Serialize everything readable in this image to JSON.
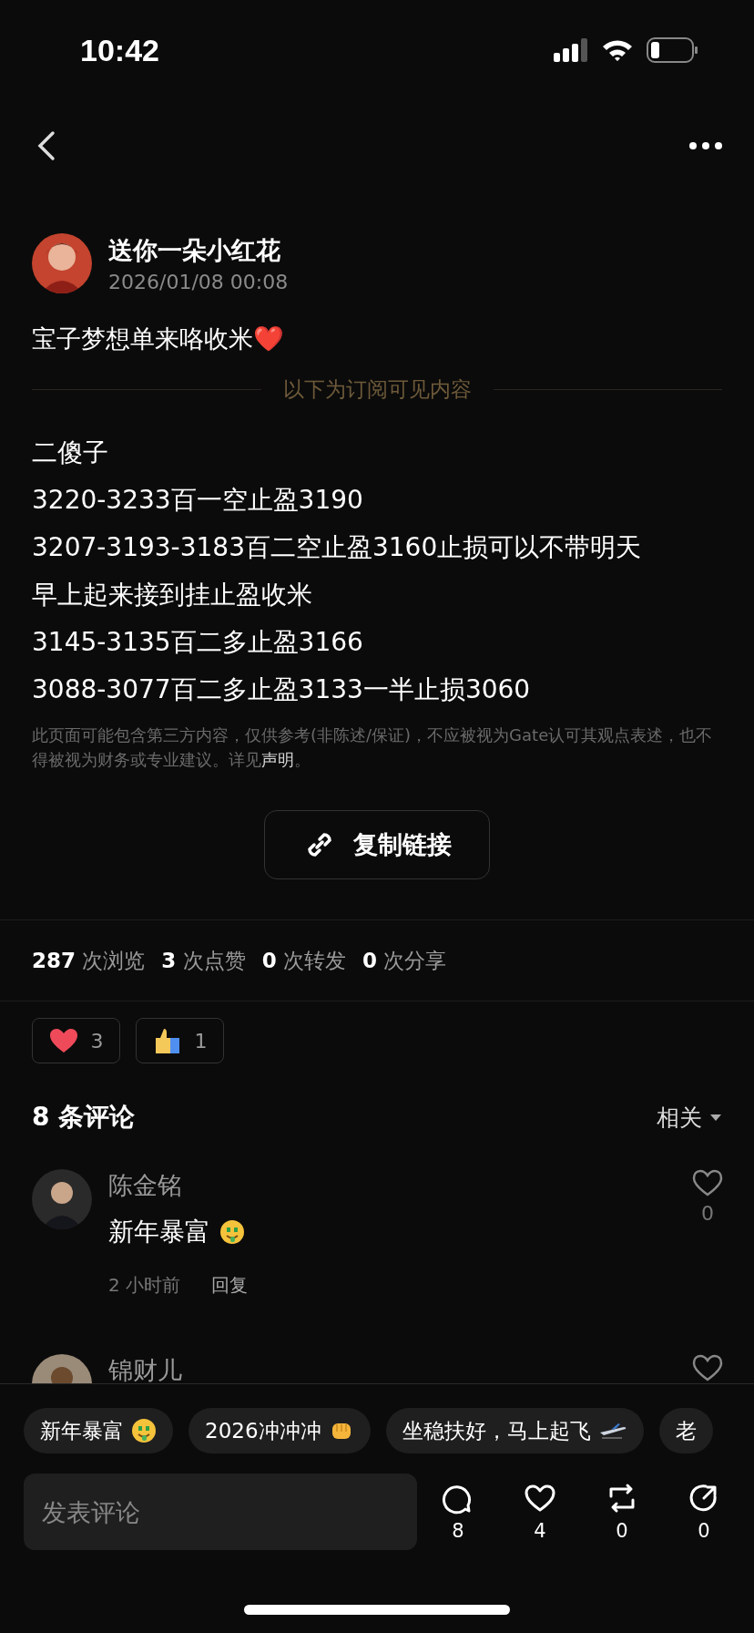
{
  "status_bar": {
    "time": "10:42"
  },
  "post": {
    "author": "送你一朵小红花",
    "date": "2026/01/08 00:08",
    "intro": "宝子梦想单来咯收米❤️",
    "divider_label": "以下为订阅可见内容",
    "lines": [
      "二傻子",
      "3220-3233百一空止盈3190",
      "3207-3193-3183百二空止盈3160止损可以不带明天",
      "早上起来接到挂止盈收米",
      "3145-3135百二多止盈3166",
      "3088-3077百二多止盈3133一半止损3060"
    ],
    "disclaimer": "此页面可能包含第三方内容，仅供参考(非陈述/保证)，不应被视为Gate认可其观点表述，也不得被视为财务或专业建议。详见",
    "disclaimer_link": "声明",
    "disclaimer_end": "。",
    "copy_button": "复制链接"
  },
  "stats": [
    "**287** 次浏览",
    "**3** 次点赞",
    "**0** 次转发",
    "**0** 次分享"
  ],
  "reactions": [
    {
      "kind": "heart",
      "count": "3"
    },
    {
      "kind": "thumb",
      "count": "1"
    }
  ],
  "comments_header": {
    "title": "8 条评论",
    "sort": "相关"
  },
  "comments": [
    {
      "name": "陈金铭",
      "text": "新年暴富",
      "kind": "money",
      "time": "2 小时前",
      "reply": "回复",
      "likes": "0"
    },
    {
      "name": "锦财儿"
    }
  ],
  "quick_replies": [
    {
      "text": "新年暴富",
      "kind": "money"
    },
    {
      "text": "2026冲冲冲",
      "kind": "fist"
    },
    {
      "text": "坐稳扶好，马上起飞",
      "kind": "plane"
    },
    {
      "text": "老",
      "kind": "plain"
    }
  ],
  "composer": {
    "placeholder": "发表评论"
  },
  "actions": [
    {
      "kind": "comment",
      "count": "8"
    },
    {
      "kind": "like",
      "count": "4"
    },
    {
      "kind": "repost",
      "count": "0"
    },
    {
      "kind": "share",
      "count": "0"
    }
  ]
}
